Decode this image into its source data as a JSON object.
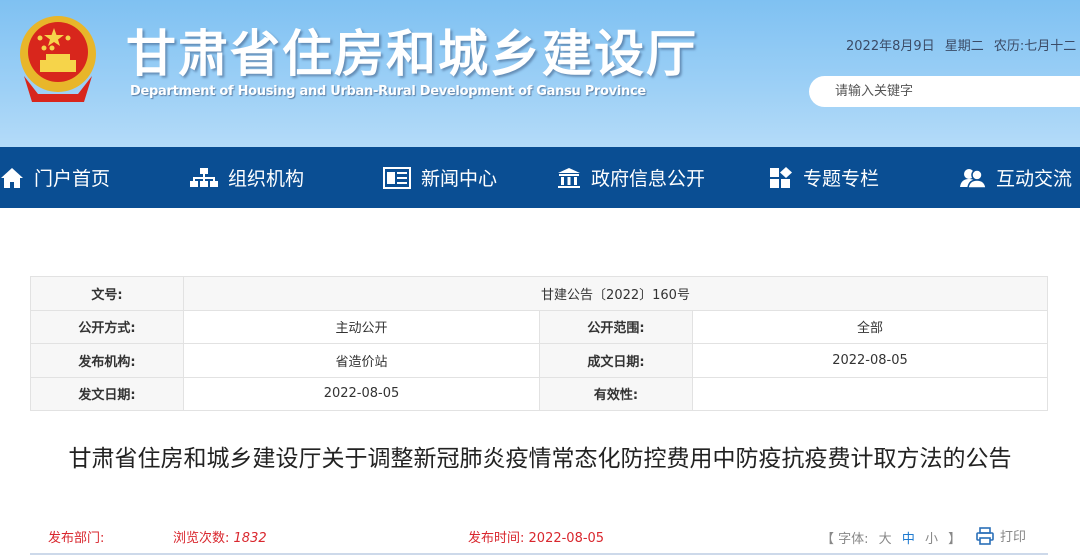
{
  "header": {
    "title": "甘肃省住房和城乡建设厅",
    "subtitle": "Department of Housing and Urban-Rural Development of Gansu Province",
    "date": "2022年8月9日 星期二 农历:七月十二",
    "search_placeholder": "请输入关键字"
  },
  "nav": {
    "items": [
      {
        "label": "门户首页",
        "icon": "home-icon"
      },
      {
        "label": "组织机构",
        "icon": "org-chart-icon"
      },
      {
        "label": "新闻中心",
        "icon": "newspaper-icon"
      },
      {
        "label": "政府信息公开",
        "icon": "government-building-icon"
      },
      {
        "label": "专题专栏",
        "icon": "grid-icon"
      },
      {
        "label": "互动交流",
        "icon": "users-icon"
      }
    ]
  },
  "info_table": {
    "doc_no_label": "文号:",
    "doc_no": "甘建公告〔2022〕160号",
    "open_mode_label": "公开方式:",
    "open_mode": "主动公开",
    "open_scope_label": "公开范围:",
    "open_scope": "全部",
    "publisher_label": "发布机构:",
    "publisher": "省造价站",
    "created_label": "成文日期:",
    "created": "2022-08-05",
    "issued_label": "发文日期:",
    "issued": "2022-08-05",
    "validity_label": "有效性:",
    "validity": ""
  },
  "article": {
    "title": "甘肃省住房和城乡建设厅关于调整新冠肺炎疫情常态化防控费用中防疫抗疫费计取方法的公告",
    "dept_label": "发布部门:",
    "views_label": "浏览次数:",
    "views": "1832",
    "time_label": "发布时间:",
    "time": "2022-08-05",
    "font_label": "【 字体:",
    "font_large": "大",
    "font_medium": "中",
    "font_small": "小",
    "font_close": "】",
    "print_label": "打印"
  }
}
